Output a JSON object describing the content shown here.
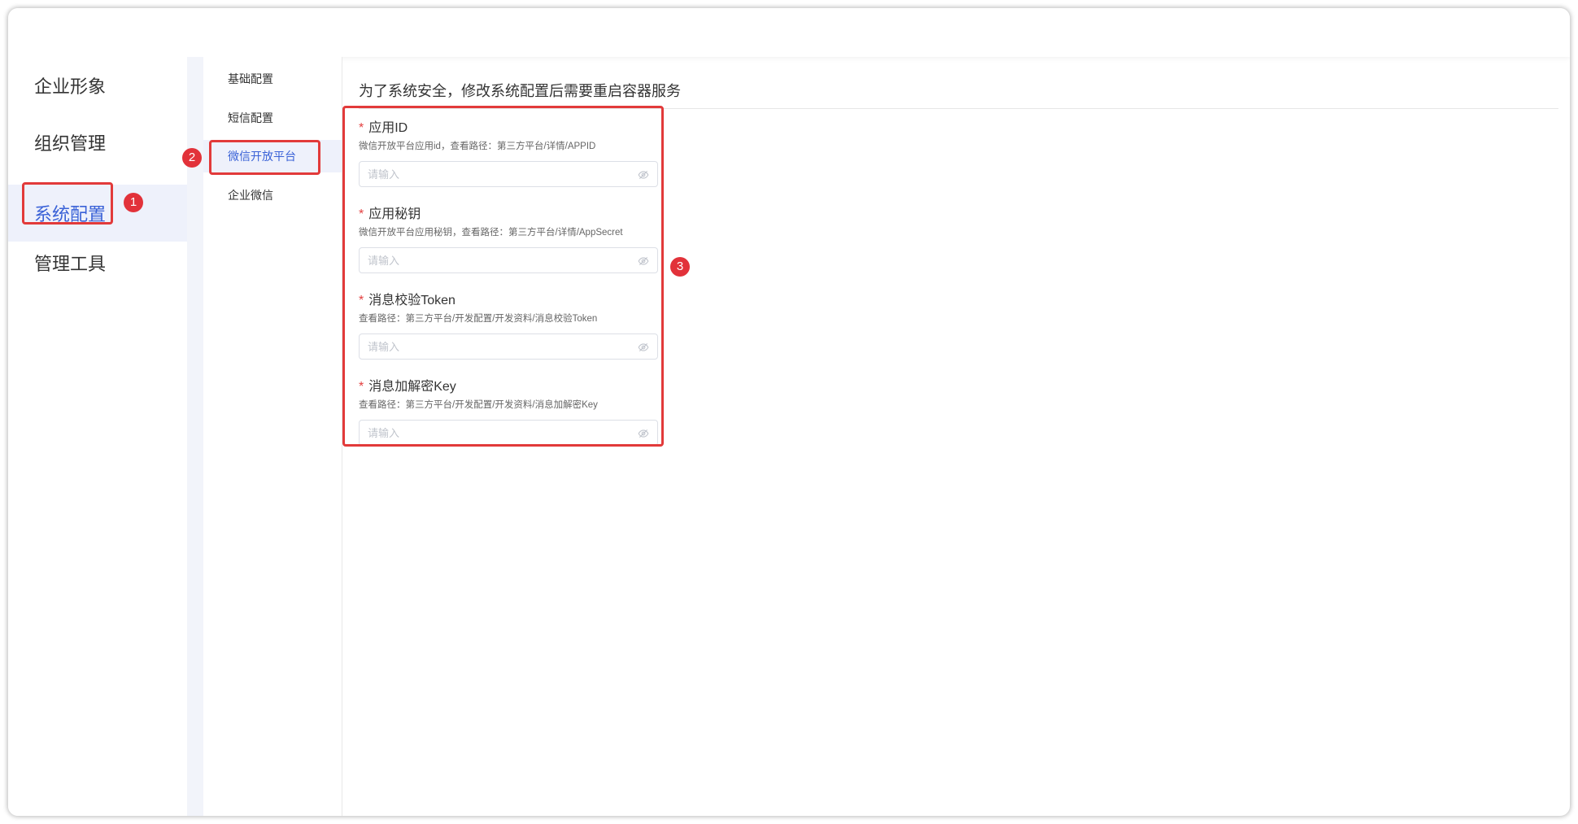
{
  "sidebar": {
    "items": [
      {
        "label": "企业形象"
      },
      {
        "label": "组织管理"
      },
      {
        "label": "系统配置"
      },
      {
        "label": "管理工具"
      }
    ],
    "active_index": 2
  },
  "subnav": {
    "items": [
      {
        "label": "基础配置"
      },
      {
        "label": "短信配置"
      },
      {
        "label": "微信开放平台"
      },
      {
        "label": "企业微信"
      }
    ],
    "active_index": 2
  },
  "main": {
    "notice": "为了系统安全，修改系统配置后需要重启容器服务",
    "fields": [
      {
        "required_mark": "*",
        "label": "应用ID",
        "hint": "微信开放平台应用id，查看路径：第三方平台/详情/APPID",
        "placeholder": "请输入",
        "value": ""
      },
      {
        "required_mark": "*",
        "label": "应用秘钥",
        "hint": "微信开放平台应用秘钥，查看路径：第三方平台/详情/AppSecret",
        "placeholder": "请输入",
        "value": ""
      },
      {
        "required_mark": "*",
        "label": "消息校验Token",
        "hint": "查看路径：第三方平台/开发配置/开发资料/消息校验Token",
        "placeholder": "请输入",
        "value": ""
      },
      {
        "required_mark": "*",
        "label": "消息加解密Key",
        "hint": "查看路径：第三方平台/开发配置/开发资料/消息加解密Key",
        "placeholder": "请输入",
        "value": ""
      }
    ]
  },
  "annotations": {
    "badges": [
      "1",
      "2",
      "3"
    ],
    "color": "#e2323a"
  },
  "colors": {
    "accent": "#3a62d7",
    "active_bg": "#eef1fb",
    "required": "#e34040"
  }
}
